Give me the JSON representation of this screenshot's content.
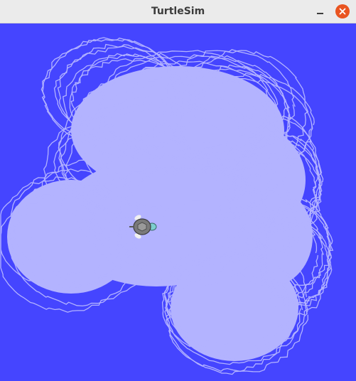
{
  "window": {
    "title": "TurtleSim",
    "minimize_icon": "minimize-icon",
    "close_icon": "close-icon"
  },
  "canvas": {
    "background_color": "#4545ff",
    "trail_color": "#b3b3ff",
    "turtle_icon": "turtle-icon"
  },
  "colors": {
    "close_button": "#e95420",
    "titlebar": "#ebebeb"
  }
}
